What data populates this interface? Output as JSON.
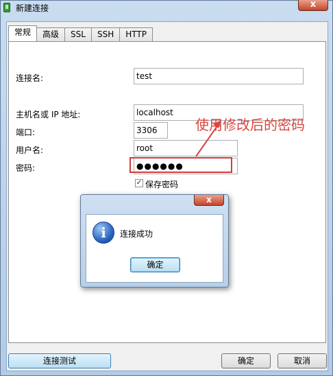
{
  "window": {
    "title": "新建连接",
    "close_glyph": "x"
  },
  "tabs": [
    {
      "label": "常规",
      "active": true
    },
    {
      "label": "高级",
      "active": false
    },
    {
      "label": "SSL",
      "active": false
    },
    {
      "label": "SSH",
      "active": false
    },
    {
      "label": "HTTP",
      "active": false
    }
  ],
  "form": {
    "connection_name_label": "连接名:",
    "connection_name_value": "test",
    "host_label": "主机名或 IP 地址:",
    "host_value": "localhost",
    "port_label": "端口:",
    "port_value": "3306",
    "user_label": "用户名:",
    "user_value": "root",
    "password_label": "密码:",
    "password_value": "●●●●●●",
    "save_password_label": "保存密码",
    "save_password_checked": true,
    "check_glyph": "✓"
  },
  "annotation": {
    "text": "使用修改后的密码",
    "color": "#d9453d"
  },
  "dialog": {
    "close_glyph": "x",
    "icon": "info-icon",
    "icon_glyph": "i",
    "message": "连接成功",
    "ok_label": "确定"
  },
  "buttons": {
    "test_label": "连接测试",
    "ok_label": "确定",
    "cancel_label": "取消"
  }
}
